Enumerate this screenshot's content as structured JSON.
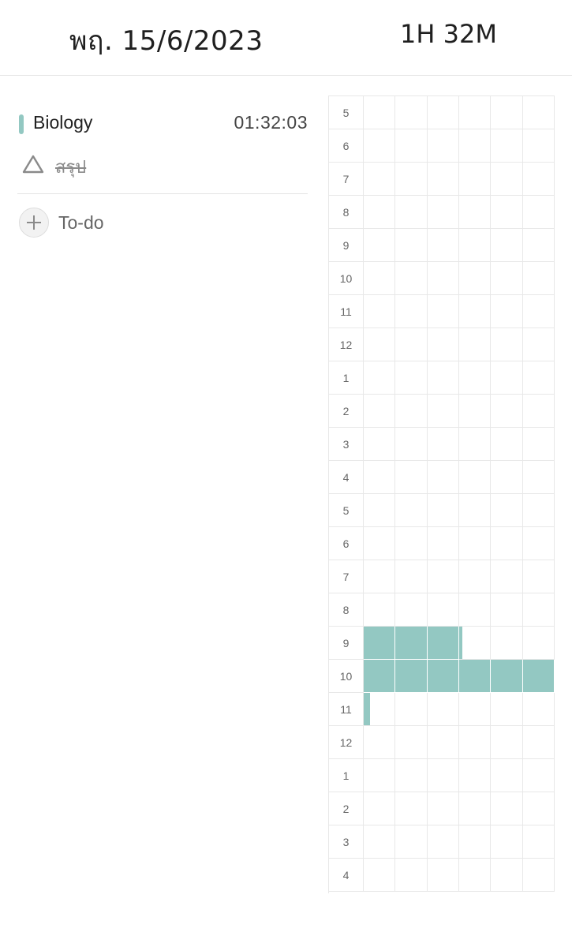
{
  "header": {
    "date": "พฤ. 15/6/2023",
    "total_time": "1H 32M"
  },
  "subjects": [
    {
      "name": "Biology",
      "time": "01:32:03",
      "color": "#93c8c2"
    }
  ],
  "tasks": [
    {
      "label": "สรุป",
      "icon": "triangle-outline-icon",
      "completed": true
    }
  ],
  "todo": {
    "label": "To-do",
    "icon": "plus-icon"
  },
  "timetable": {
    "fill_color": "#93c8c2",
    "minutes_per_cell": 10,
    "rows": [
      {
        "hour": "5",
        "filled": [
          0,
          0,
          0,
          0,
          0,
          0
        ]
      },
      {
        "hour": "6",
        "filled": [
          0,
          0,
          0,
          0,
          0,
          0
        ]
      },
      {
        "hour": "7",
        "filled": [
          0,
          0,
          0,
          0,
          0,
          0
        ]
      },
      {
        "hour": "8",
        "filled": [
          0,
          0,
          0,
          0,
          0,
          0
        ]
      },
      {
        "hour": "9",
        "filled": [
          0,
          0,
          0,
          0,
          0,
          0
        ]
      },
      {
        "hour": "10",
        "filled": [
          0,
          0,
          0,
          0,
          0,
          0
        ]
      },
      {
        "hour": "11",
        "filled": [
          0,
          0,
          0,
          0,
          0,
          0
        ]
      },
      {
        "hour": "12",
        "filled": [
          0,
          0,
          0,
          0,
          0,
          0
        ]
      },
      {
        "hour": "1",
        "filled": [
          0,
          0,
          0,
          0,
          0,
          0
        ]
      },
      {
        "hour": "2",
        "filled": [
          0,
          0,
          0,
          0,
          0,
          0
        ]
      },
      {
        "hour": "3",
        "filled": [
          0,
          0,
          0,
          0,
          0,
          0
        ]
      },
      {
        "hour": "4",
        "filled": [
          0,
          0,
          0,
          0,
          0,
          0
        ]
      },
      {
        "hour": "5",
        "filled": [
          0,
          0,
          0,
          0,
          0,
          0
        ]
      },
      {
        "hour": "6",
        "filled": [
          0,
          0,
          0,
          0,
          0,
          0
        ]
      },
      {
        "hour": "7",
        "filled": [
          0,
          0,
          0,
          0,
          0,
          0
        ]
      },
      {
        "hour": "8",
        "filled": [
          0,
          0,
          0,
          0,
          0,
          0
        ]
      },
      {
        "hour": "9",
        "filled": [
          1,
          1,
          1,
          0.1,
          0,
          0
        ]
      },
      {
        "hour": "10",
        "filled": [
          1,
          1,
          1,
          1,
          1,
          1
        ]
      },
      {
        "hour": "11",
        "filled": [
          0.2,
          0,
          0,
          0,
          0,
          0
        ]
      },
      {
        "hour": "12",
        "filled": [
          0,
          0,
          0,
          0,
          0,
          0
        ]
      },
      {
        "hour": "1",
        "filled": [
          0,
          0,
          0,
          0,
          0,
          0
        ]
      },
      {
        "hour": "2",
        "filled": [
          0,
          0,
          0,
          0,
          0,
          0
        ]
      },
      {
        "hour": "3",
        "filled": [
          0,
          0,
          0,
          0,
          0,
          0
        ]
      },
      {
        "hour": "4",
        "filled": [
          0,
          0,
          0,
          0,
          0,
          0
        ]
      }
    ]
  }
}
